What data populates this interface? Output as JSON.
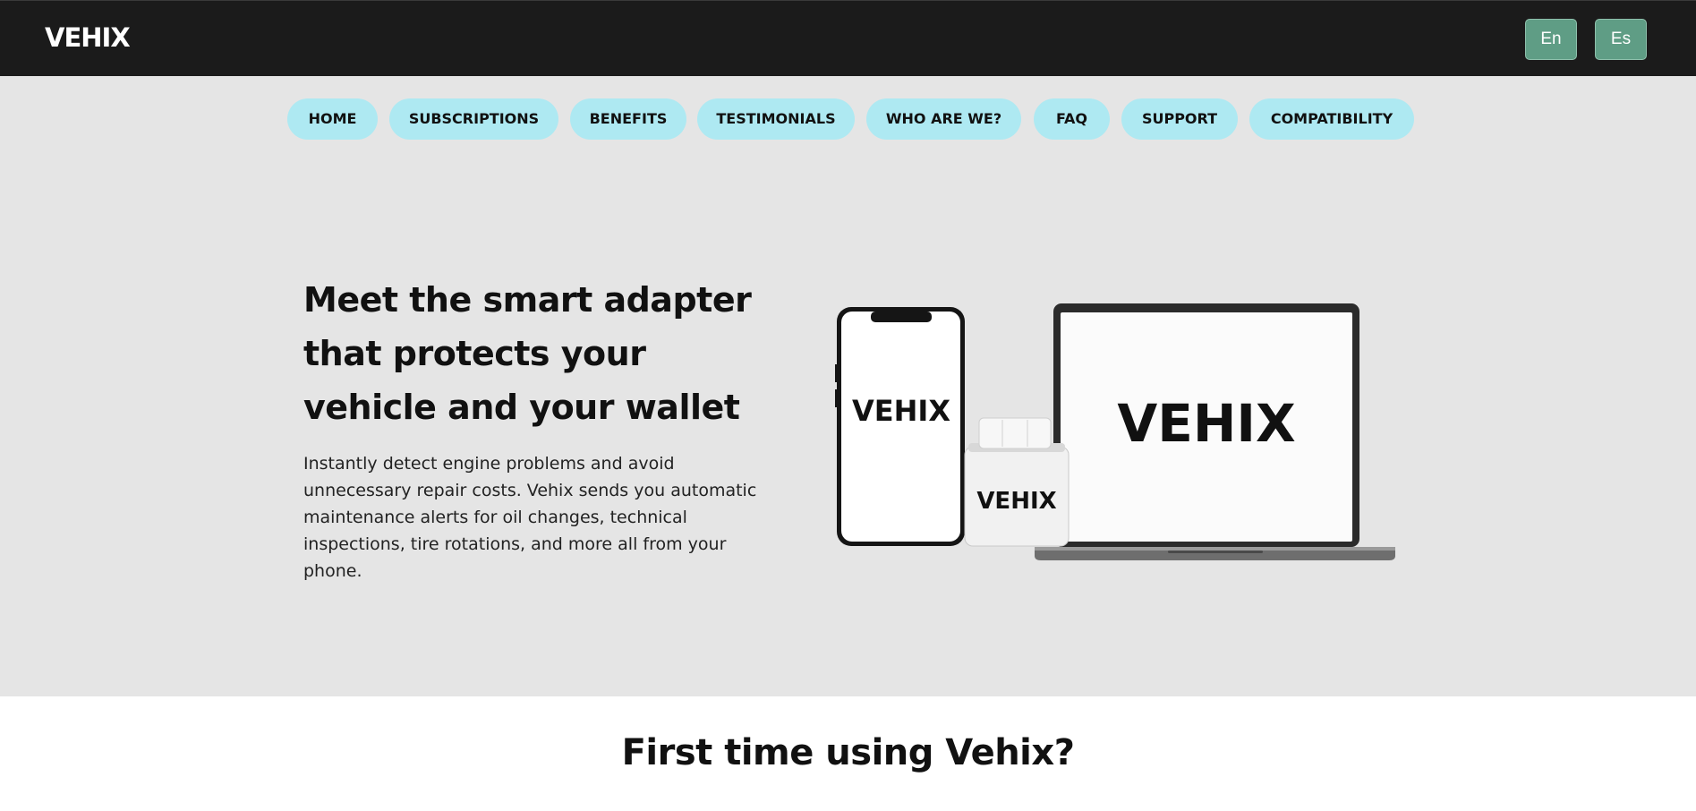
{
  "header": {
    "brand": "VEHIX",
    "languages": [
      "En",
      "Es"
    ]
  },
  "nav": {
    "items": [
      "HOME",
      "SUBSCRIPTIONS",
      "BENEFITS",
      "TESTIMONIALS",
      "WHO ARE WE?",
      "FAQ",
      "SUPPORT",
      "COMPATIBILITY"
    ]
  },
  "hero": {
    "title": "Meet the smart adapter that protects your vehicle and your wallet",
    "description": "Instantly detect engine problems and avoid unnecessary repair costs. Vehix sends you automatic maintenance alerts for oil changes, technical inspections, tire rotations, and more all from your phone.",
    "illustration": {
      "phone_label": "VEHIX",
      "adapter_label": "VEHIX",
      "laptop_label": "VEHIX"
    }
  },
  "section": {
    "title": "First time using Vehix?"
  },
  "colors": {
    "topbar": "#1b1b1b",
    "hero_bg": "#e5e5e5",
    "nav_pill": "#aee9f2",
    "lang_button": "#5f9d85"
  }
}
